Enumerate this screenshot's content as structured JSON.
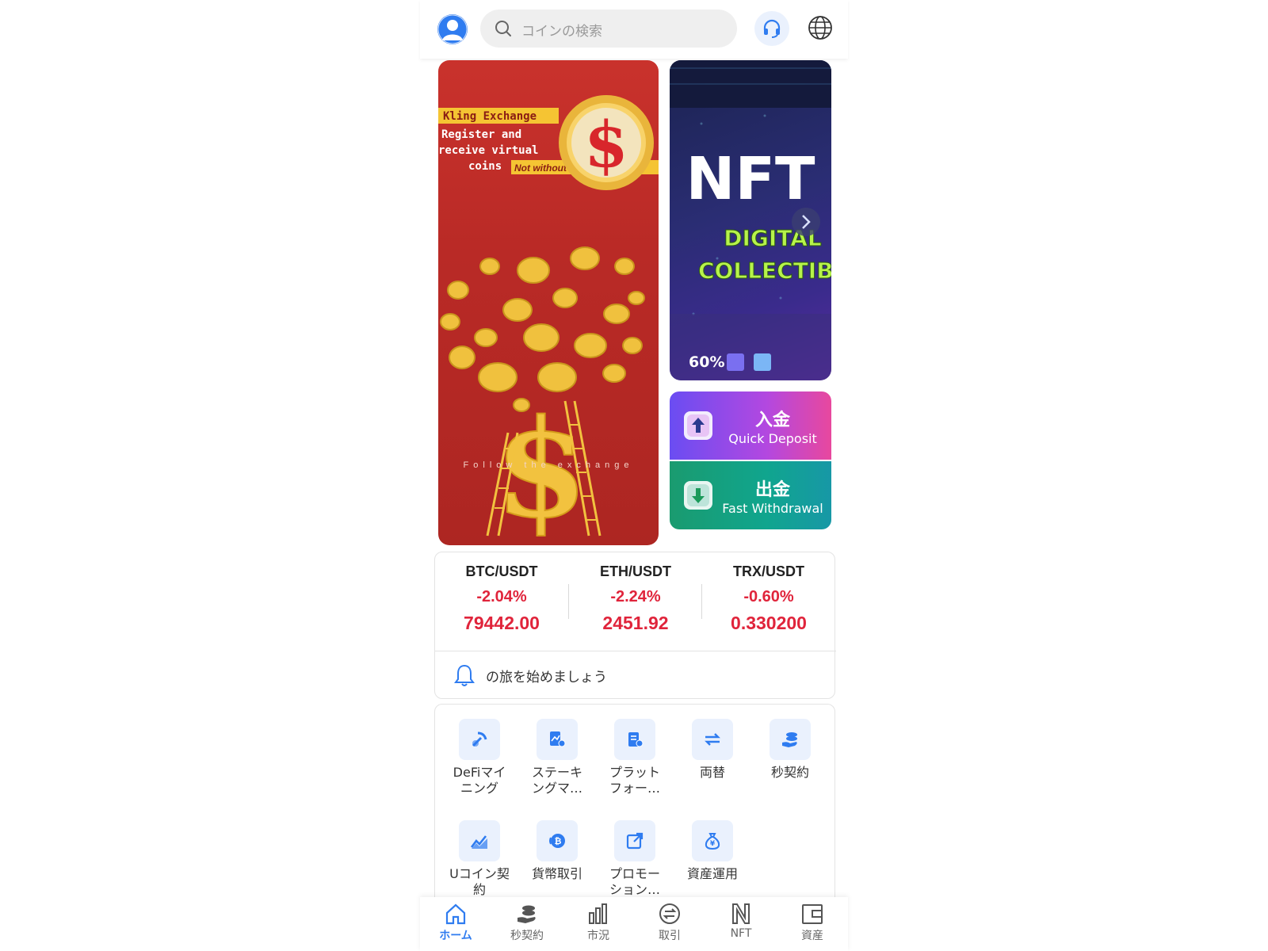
{
  "header": {
    "search_placeholder": "コインの検索",
    "avatar_icon": "user-avatar-icon",
    "support_icon": "headset-icon",
    "language_icon": "globe-icon"
  },
  "banner_left": {
    "line1": "Kling Exchange",
    "line2": "Register and",
    "line3": "receive virtual",
    "line4": "coins",
    "tagline": "Not without a million dollars",
    "footer": "Follow the exchange"
  },
  "banner_right": {
    "title": "NFT",
    "subtitle1": "DIGITAL",
    "subtitle2": "COLLECTIBLES",
    "percent": "60%",
    "next_icon": "chevron-right-icon"
  },
  "actions": {
    "deposit_title": "入金",
    "deposit_sub": "Quick Deposit",
    "withdraw_title": "出金",
    "withdraw_sub": "Fast Withdrawal"
  },
  "tickers": [
    {
      "pair": "BTC/USDT",
      "change": "-2.04%",
      "price": "79442.00"
    },
    {
      "pair": "ETH/USDT",
      "change": "-2.24%",
      "price": "2451.92"
    },
    {
      "pair": "TRX/USDT",
      "change": "-0.60%",
      "price": "0.330200"
    }
  ],
  "notice": {
    "text": "の旅を始めましょう"
  },
  "menu": [
    {
      "label": "DeFiマイ\nニング",
      "icon": "mining-icon"
    },
    {
      "label": "ステーキ\nングマ…",
      "icon": "staking-icon"
    },
    {
      "label": "プラット\nフォー…",
      "icon": "platform-icon"
    },
    {
      "label": "両替",
      "icon": "exchange-arrows-icon"
    },
    {
      "label": "秒契約",
      "icon": "seconds-contract-icon"
    },
    {
      "label": "Uコイン契\n約",
      "icon": "trend-chart-icon"
    },
    {
      "label": "貨幣取引",
      "icon": "bitcoin-icon"
    },
    {
      "label": "プロモー\nション…",
      "icon": "share-icon"
    },
    {
      "label": "資産運用",
      "icon": "money-bag-icon"
    }
  ],
  "nav": [
    {
      "label": "ホーム",
      "icon": "home-icon"
    },
    {
      "label": "秒契約",
      "icon": "coins-hand-icon"
    },
    {
      "label": "市況",
      "icon": "bar-chart-icon"
    },
    {
      "label": "取引",
      "icon": "trade-icon"
    },
    {
      "label": "NFT",
      "icon": "nft-icon"
    },
    {
      "label": "資産",
      "icon": "wallet-icon"
    }
  ]
}
